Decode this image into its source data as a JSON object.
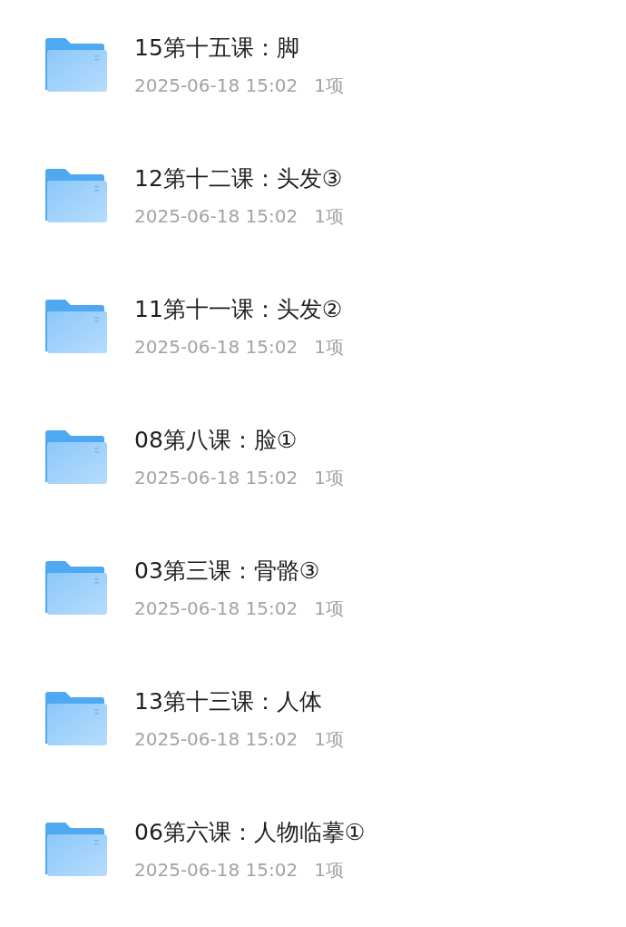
{
  "folders": [
    {
      "name": "15第十五课：脚",
      "date": "2025-06-18 15:02",
      "count": "1项"
    },
    {
      "name": "12第十二课：头发③",
      "date": "2025-06-18 15:02",
      "count": "1项"
    },
    {
      "name": "11第十一课：头发②",
      "date": "2025-06-18 15:02",
      "count": "1项"
    },
    {
      "name": "08第八课：脸①",
      "date": "2025-06-18 15:02",
      "count": "1项"
    },
    {
      "name": "03第三课：骨骼③",
      "date": "2025-06-18 15:02",
      "count": "1项"
    },
    {
      "name": "13第十三课：人体",
      "date": "2025-06-18 15:02",
      "count": "1项"
    },
    {
      "name": "06第六课：人物临摹①",
      "date": "2025-06-18 15:02",
      "count": "1项"
    }
  ]
}
